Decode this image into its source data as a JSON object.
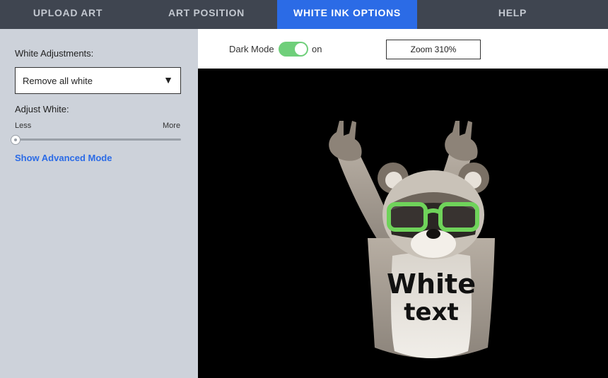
{
  "tabs": [
    {
      "label": "UPLOAD ART"
    },
    {
      "label": "ART POSITION"
    },
    {
      "label": "WHITE INK OPTIONS",
      "active": true
    },
    {
      "label": "HELP"
    }
  ],
  "sidebar": {
    "white_adjustments_label": "White Adjustments:",
    "select_value": "Remove all white",
    "adjust_white_label": "Adjust White:",
    "slider_min_label": "Less",
    "slider_max_label": "More",
    "slider_value": 0,
    "advanced_link": "Show Advanced Mode"
  },
  "toolbar": {
    "dark_mode_label": "Dark Mode",
    "dark_mode_on": true,
    "dark_mode_state": "on",
    "zoom_label": "Zoom 310%"
  },
  "artwork": {
    "text_line1": "White",
    "text_line2": "text",
    "glasses_color": "#6fd35a"
  },
  "colors": {
    "tab_bar": "#3f4550",
    "tab_active": "#2b6be6",
    "sidebar_bg": "#cdd2da",
    "link": "#2b6be6",
    "toggle_on": "#6fcf7a",
    "canvas_bg": "#000000"
  }
}
